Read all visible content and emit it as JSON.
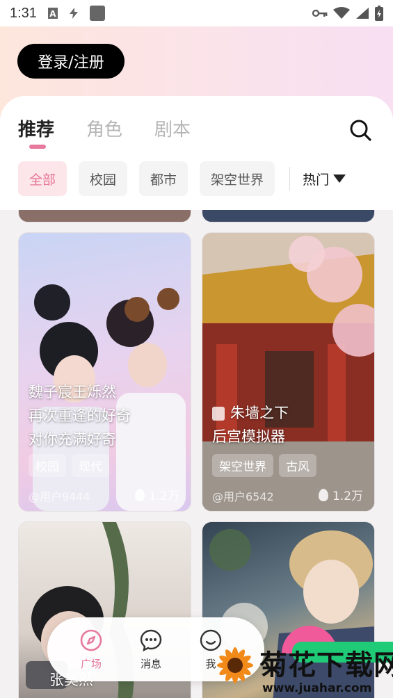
{
  "status_bar": {
    "time": "1:31"
  },
  "header": {
    "login_label": "登录/注册"
  },
  "tabs": [
    {
      "label": "推荐",
      "active": true
    },
    {
      "label": "角色",
      "active": false
    },
    {
      "label": "剧本",
      "active": false
    }
  ],
  "filters": {
    "chips": [
      {
        "label": "全部",
        "active": true
      },
      {
        "label": "校园",
        "active": false
      },
      {
        "label": "都市",
        "active": false
      },
      {
        "label": "架空世界",
        "active": false
      }
    ],
    "sort_label": "热门"
  },
  "cards": [
    {
      "title_lines": [
        "魏子宸王烁然",
        "再次重逢的好奇",
        "对你充满好奇"
      ],
      "tags": [
        "校园",
        "现代"
      ],
      "user": "@用户9444",
      "hot": "1.2万"
    },
    {
      "title_lines": [
        "朱墙之下",
        "后宫模拟器"
      ],
      "tags": [
        "架空世界",
        "古风"
      ],
      "user": "@用户6542",
      "hot": "1.2万"
    },
    {
      "title_lines": [
        "张昊然"
      ]
    }
  ],
  "bottom_nav": [
    {
      "label": "广场",
      "active": true,
      "icon": "compass-icon"
    },
    {
      "label": "消息",
      "active": false,
      "icon": "chat-icon"
    },
    {
      "label": "我",
      "active": false,
      "icon": "smile-icon"
    }
  ],
  "watermark": {
    "text": "菊花下载网",
    "url": "www.juahar.com"
  },
  "colors": {
    "accent": "#e6799c",
    "chip_active_bg": "#fde6ea",
    "login_bg": "#000000"
  }
}
